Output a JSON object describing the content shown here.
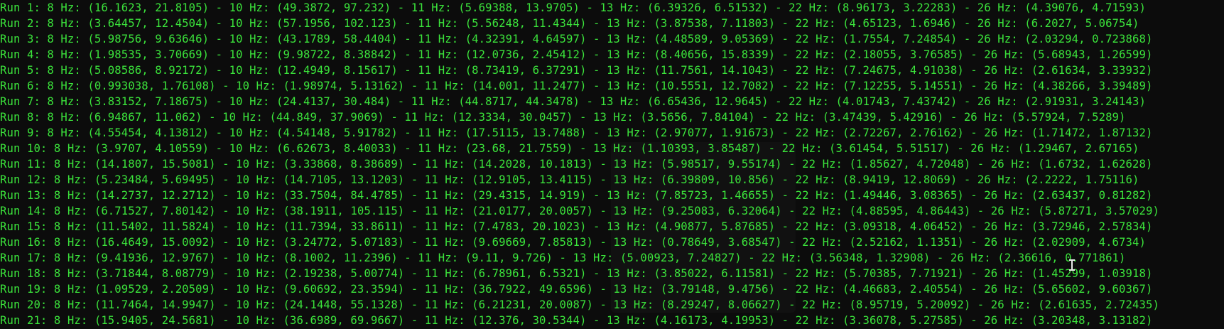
{
  "colors": {
    "background": "#0c0c0c",
    "text": "#3be33b"
  },
  "cursor_icon": "i-beam-text-cursor",
  "terminal": {
    "lines": [
      "Run 1: 8 Hz: (16.1623, 21.8105) - 10 Hz: (49.3872, 97.232) - 11 Hz: (5.69388, 13.9705) - 13 Hz: (6.39326, 6.51532) - 22 Hz: (8.96173, 3.22283) - 26 Hz: (4.39076, 4.71593)",
      "Run 2: 8 Hz: (3.64457, 12.4504) - 10 Hz: (57.1956, 102.123) - 11 Hz: (5.56248, 11.4344) - 13 Hz: (3.87538, 7.11803) - 22 Hz: (4.65123, 1.6946) - 26 Hz: (6.2027, 5.06754)",
      "Run 3: 8 Hz: (5.98756, 9.63646) - 10 Hz: (43.1789, 58.4404) - 11 Hz: (4.32391, 4.64597) - 13 Hz: (4.48589, 9.05369) - 22 Hz: (1.7554, 7.24854) - 26 Hz: (2.03294, 0.723868)",
      "Run 4: 8 Hz: (1.98535, 3.70669) - 10 Hz: (9.98722, 8.38842) - 11 Hz: (12.0736, 2.45412) - 13 Hz: (8.40656, 15.8339) - 22 Hz: (2.18055, 3.76585) - 26 Hz: (5.68943, 1.26599)",
      "Run 5: 8 Hz: (5.08586, 8.92172) - 10 Hz: (12.4949, 8.15617) - 11 Hz: (8.73419, 6.37291) - 13 Hz: (11.7561, 14.1043) - 22 Hz: (7.24675, 4.91038) - 26 Hz: (2.61634, 3.33932)",
      "Run 6: 8 Hz: (0.993038, 1.76108) - 10 Hz: (1.98974, 5.13162) - 11 Hz: (14.001, 11.2477) - 13 Hz: (10.5551, 12.7082) - 22 Hz: (7.12255, 5.14551) - 26 Hz: (4.38266, 3.39489)",
      "Run 7: 8 Hz: (3.83152, 7.18675) - 10 Hz: (24.4137, 30.484) - 11 Hz: (44.8717, 44.3478) - 13 Hz: (6.65436, 12.9645) - 22 Hz: (4.01743, 7.43742) - 26 Hz: (2.91931, 3.24143)",
      "Run 8: 8 Hz: (6.94867, 11.062) - 10 Hz: (44.849, 37.9069) - 11 Hz: (12.3334, 30.0457) - 13 Hz: (3.5656, 7.84104) - 22 Hz: (3.47439, 5.42916) - 26 Hz: (5.57924, 7.5289)",
      "Run 9: 8 Hz: (4.55454, 4.13812) - 10 Hz: (4.54148, 5.91782) - 11 Hz: (17.5115, 13.7488) - 13 Hz: (2.97077, 1.91673) - 22 Hz: (2.72267, 2.76162) - 26 Hz: (1.71472, 1.87132)",
      "Run 10: 8 Hz: (3.9707, 4.10559) - 10 Hz: (6.62673, 8.40033) - 11 Hz: (23.68, 21.7559) - 13 Hz: (1.10393, 3.85487) - 22 Hz: (3.61454, 5.51517) - 26 Hz: (1.29467, 2.67165)",
      "Run 11: 8 Hz: (14.1807, 15.5081) - 10 Hz: (3.33868, 8.38689) - 11 Hz: (14.2028, 10.1813) - 13 Hz: (5.98517, 9.55174) - 22 Hz: (1.85627, 4.72048) - 26 Hz: (1.6732, 1.62628)",
      "Run 12: 8 Hz: (5.23484, 5.69495) - 10 Hz: (14.7105, 13.1203) - 11 Hz: (12.9105, 13.4115) - 13 Hz: (6.39809, 10.856) - 22 Hz: (8.9419, 12.8069) - 26 Hz: (2.2222, 1.75116)",
      "Run 13: 8 Hz: (14.2737, 12.2712) - 10 Hz: (33.7504, 84.4785) - 11 Hz: (29.4315, 14.919) - 13 Hz: (7.85723, 1.46655) - 22 Hz: (1.49446, 3.08365) - 26 Hz: (2.63437, 0.81282)",
      "Run 14: 8 Hz: (6.71527, 7.80142) - 10 Hz: (38.1911, 105.115) - 11 Hz: (21.0177, 20.0057) - 13 Hz: (9.25083, 6.32064) - 22 Hz: (4.88595, 4.86443) - 26 Hz: (5.87271, 3.57029)",
      "Run 15: 8 Hz: (11.5402, 11.5824) - 10 Hz: (11.7394, 33.8611) - 11 Hz: (7.4783, 20.1023) - 13 Hz: (4.90877, 5.87685) - 22 Hz: (3.09318, 4.06452) - 26 Hz: (3.72946, 2.57834)",
      "Run 16: 8 Hz: (16.4649, 15.0092) - 10 Hz: (3.24772, 5.07183) - 11 Hz: (9.69669, 7.85813) - 13 Hz: (0.78649, 3.68547) - 22 Hz: (2.52162, 1.1351) - 26 Hz: (2.02909, 4.6734)",
      "Run 17: 8 Hz: (9.41936, 12.9767) - 10 Hz: (8.1002, 11.2396) - 11 Hz: (9.11, 9.726) - 13 Hz: (5.00923, 7.24827) - 22 Hz: (3.56348, 1.32908) - 26 Hz: (2.36616, 0.771861)",
      "Run 18: 8 Hz: (3.71844, 8.08779) - 10 Hz: (2.19238, 5.00774) - 11 Hz: (6.78961, 6.5321) - 13 Hz: (3.85022, 6.11581) - 22 Hz: (5.70385, 7.71921) - 26 Hz: (1.45299, 1.03918)",
      "Run 19: 8 Hz: (1.09529, 2.20509) - 10 Hz: (9.60692, 23.3594) - 11 Hz: (36.7922, 49.6596) - 13 Hz: (3.79148, 9.4756) - 22 Hz: (4.46683, 2.40554) - 26 Hz: (5.65602, 9.60367)",
      "Run 20: 8 Hz: (11.7464, 14.9947) - 10 Hz: (24.1448, 55.1328) - 11 Hz: (6.21231, 20.0087) - 13 Hz: (8.29247, 8.06627) - 22 Hz: (8.95719, 5.20092) - 26 Hz: (2.61635, 2.72435)",
      "Run 21: 8 Hz: (15.9405, 24.5681) - 10 Hz: (36.6989, 69.9667) - 11 Hz: (12.376, 30.5344) - 13 Hz: (4.16173, 4.19953) - 22 Hz: (3.36078, 5.27585) - 26 Hz: (3.20348, 3.13182)"
    ]
  }
}
